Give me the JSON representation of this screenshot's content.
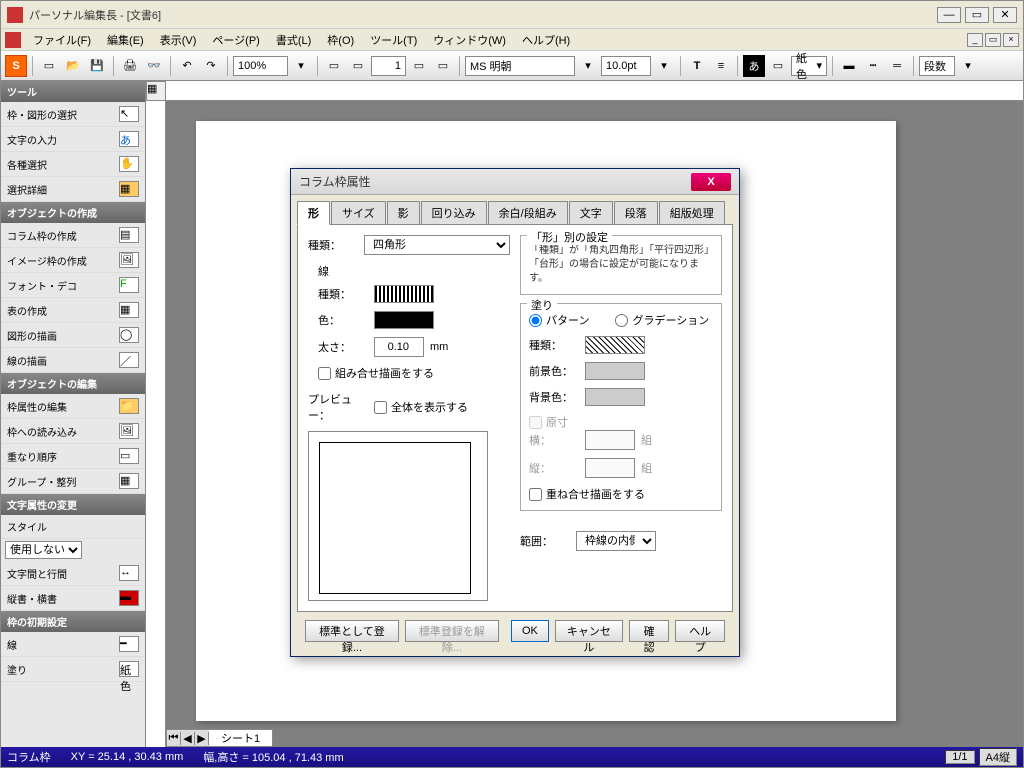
{
  "window": {
    "title": "パーソナル編集長 - [文書6]"
  },
  "menubar": [
    "ファイル(F)",
    "編集(E)",
    "表示(V)",
    "ページ(P)",
    "書式(L)",
    "枠(O)",
    "ツール(T)",
    "ウィンドウ(W)",
    "ヘルプ(H)"
  ],
  "toolbar": {
    "zoom": "100%",
    "page": "1",
    "font": "MS 明朝",
    "size": "10.0pt",
    "fill_label": "紙色",
    "dan": "段数"
  },
  "sidebar": {
    "h1": "ツール",
    "g1": [
      {
        "label": "枠・図形の選択"
      },
      {
        "label": "文字の入力"
      },
      {
        "label": "各種選択"
      },
      {
        "label": "選択詳細"
      }
    ],
    "h2": "オブジェクトの作成",
    "g2": [
      {
        "label": "コラム枠の作成"
      },
      {
        "label": "イメージ枠の作成"
      },
      {
        "label": "フォント・デコ"
      },
      {
        "label": "表の作成"
      },
      {
        "label": "図形の描画"
      },
      {
        "label": "線の描画"
      }
    ],
    "h3": "オブジェクトの編集",
    "g3": [
      {
        "label": "枠属性の編集"
      },
      {
        "label": "枠への読み込み"
      },
      {
        "label": "重なり順序"
      },
      {
        "label": "グループ・整列"
      }
    ],
    "h4": "文字属性の変更",
    "style_label": "スタイル",
    "style_value": "使用しない",
    "g4": [
      {
        "label": "文字間と行間"
      },
      {
        "label": "縦書・横書"
      }
    ],
    "h5": "枠の初期設定",
    "line_label": "線",
    "fill_label": "塗り",
    "fill_value": "紙色"
  },
  "dialog": {
    "title": "コラム枠属性",
    "tabs": [
      "形",
      "サイズ",
      "影",
      "回り込み",
      "余白/段組み",
      "文字",
      "段落",
      "組版処理"
    ],
    "active_tab": 0,
    "shape": {
      "type_label": "種類：",
      "type_value": "四角形",
      "line_group": "線",
      "line_type_label": "種類：",
      "line_color_label": "色：",
      "line_weight_label": "太さ：",
      "line_weight_value": "0.10",
      "line_weight_unit": "mm",
      "combine_label": "組み合せ描画をする",
      "preview_label": "プレビュー：",
      "preview_all_label": "全体を表示する"
    },
    "right": {
      "shape_settings": "「形」別の設定",
      "shape_help": "「種類」が「角丸四角形」「平行四辺形」「台形」の場合に設定が可能になります。",
      "fill_group": "塗り",
      "pattern_label": "パターン",
      "gradient_label": "グラデーション",
      "fill_type_label": "種類：",
      "fg_label": "前景色：",
      "bg_label": "背景色：",
      "original_label": "原寸",
      "h_label": "横：",
      "v_label": "縦：",
      "unit_label": "組",
      "overlay_label": "重ね合せ描画をする",
      "range_label": "範囲：",
      "range_value": "枠線の内側"
    },
    "buttons": {
      "save_std": "標準として登録...",
      "clear_std": "標準登録を解除...",
      "ok": "OK",
      "cancel": "キャンセル",
      "confirm": "確認",
      "help": "ヘルプ"
    }
  },
  "status": {
    "frame": "コラム枠",
    "xy": "XY = 25.14 , 30.43 mm",
    "wh": "幅,高さ = 105.04 , 71.43 mm",
    "page": "1/1",
    "paper": "A4縦"
  },
  "sheet_tab": "シート1"
}
